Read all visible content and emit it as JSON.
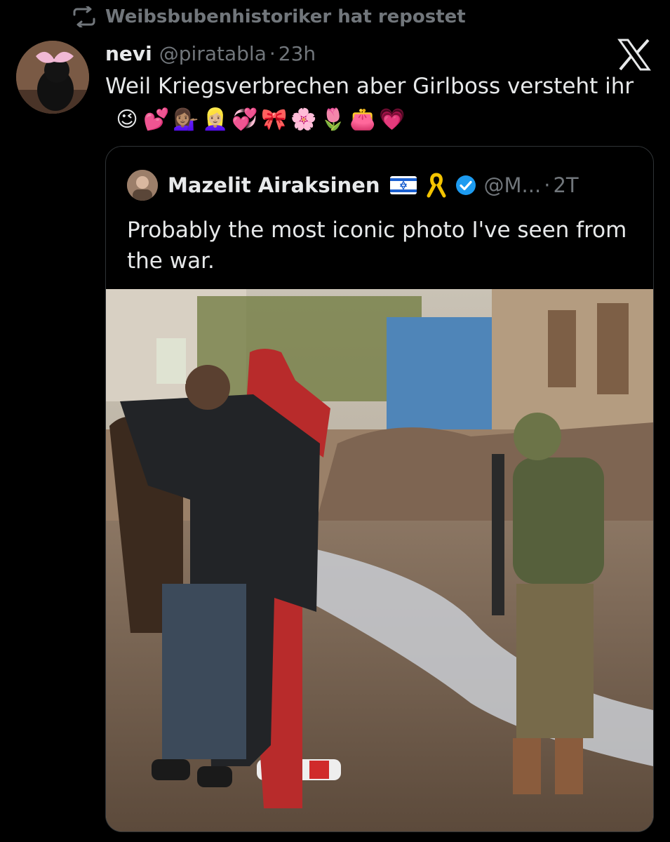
{
  "repost": {
    "icon": "repost-icon",
    "text": "Weibsbubenhistoriker hat repostet"
  },
  "post": {
    "author": "nevi",
    "handle": "@piratabla",
    "separator": "·",
    "time": "23h",
    "text": "Weil Kriegsverbrechen aber Girlboss versteht ihr",
    "emojis": [
      "😉",
      "💕",
      "💁🏽‍♀️",
      "👱🏼‍♀️",
      "💞",
      "🎀",
      "🌸",
      "🌷",
      "👛",
      "💗"
    ]
  },
  "quote": {
    "author": "Mazelit Airaksinen",
    "handle": "@M...",
    "separator": "·",
    "time": "2T",
    "text": "Probably the most iconic photo I've seen from the war.",
    "photo": "war-photo"
  },
  "colors": {
    "background": "#000000",
    "text": "#e7e9ea",
    "muted": "#71767b",
    "border": "#2f3336",
    "verified": "#1d9bf0"
  }
}
